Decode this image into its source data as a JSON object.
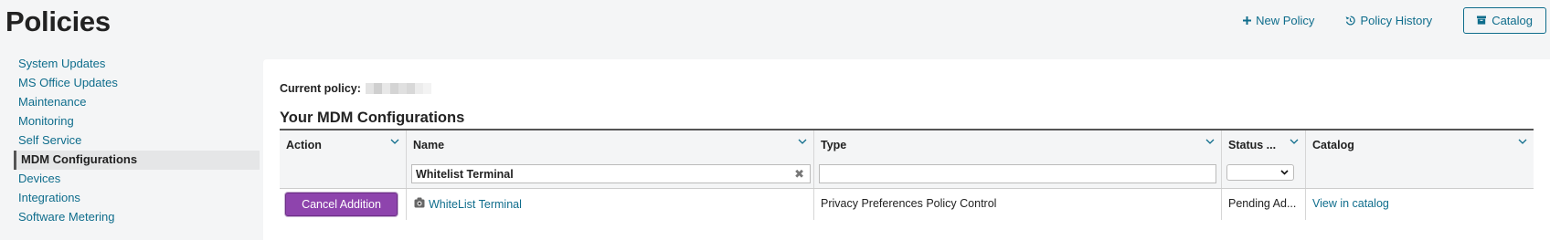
{
  "page": {
    "title": "Policies"
  },
  "top_actions": {
    "new_policy": "New Policy",
    "policy_history": "Policy History",
    "catalog": "Catalog"
  },
  "sidebar": {
    "items": [
      {
        "label": "System Updates",
        "active": false
      },
      {
        "label": "MS Office Updates",
        "active": false
      },
      {
        "label": "Maintenance",
        "active": false
      },
      {
        "label": "Monitoring",
        "active": false
      },
      {
        "label": "Self Service",
        "active": false
      },
      {
        "label": "MDM Configurations",
        "active": true
      },
      {
        "label": "Devices",
        "active": false
      },
      {
        "label": "Integrations",
        "active": false
      },
      {
        "label": "Software Metering",
        "active": false
      }
    ]
  },
  "main": {
    "current_policy_label": "Current policy:",
    "section_title": "Your MDM Configurations",
    "columns": [
      {
        "label": "Action"
      },
      {
        "label": "Name",
        "filter_value": "Whitelist Terminal"
      },
      {
        "label": "Type",
        "filter_value": ""
      },
      {
        "label": "Status ...",
        "filter_value": ""
      },
      {
        "label": "Catalog"
      }
    ],
    "rows": [
      {
        "action_label": "Cancel Addition",
        "name": "WhiteList Terminal",
        "name_icon": "configuration-profile-icon",
        "type": "Privacy Preferences Policy Control",
        "status": "Pending Ad...",
        "catalog": "View in catalog"
      }
    ]
  },
  "colors": {
    "link": "#0f6d8c",
    "action_button": "#8e44ad",
    "background": "#f4f5f6"
  }
}
